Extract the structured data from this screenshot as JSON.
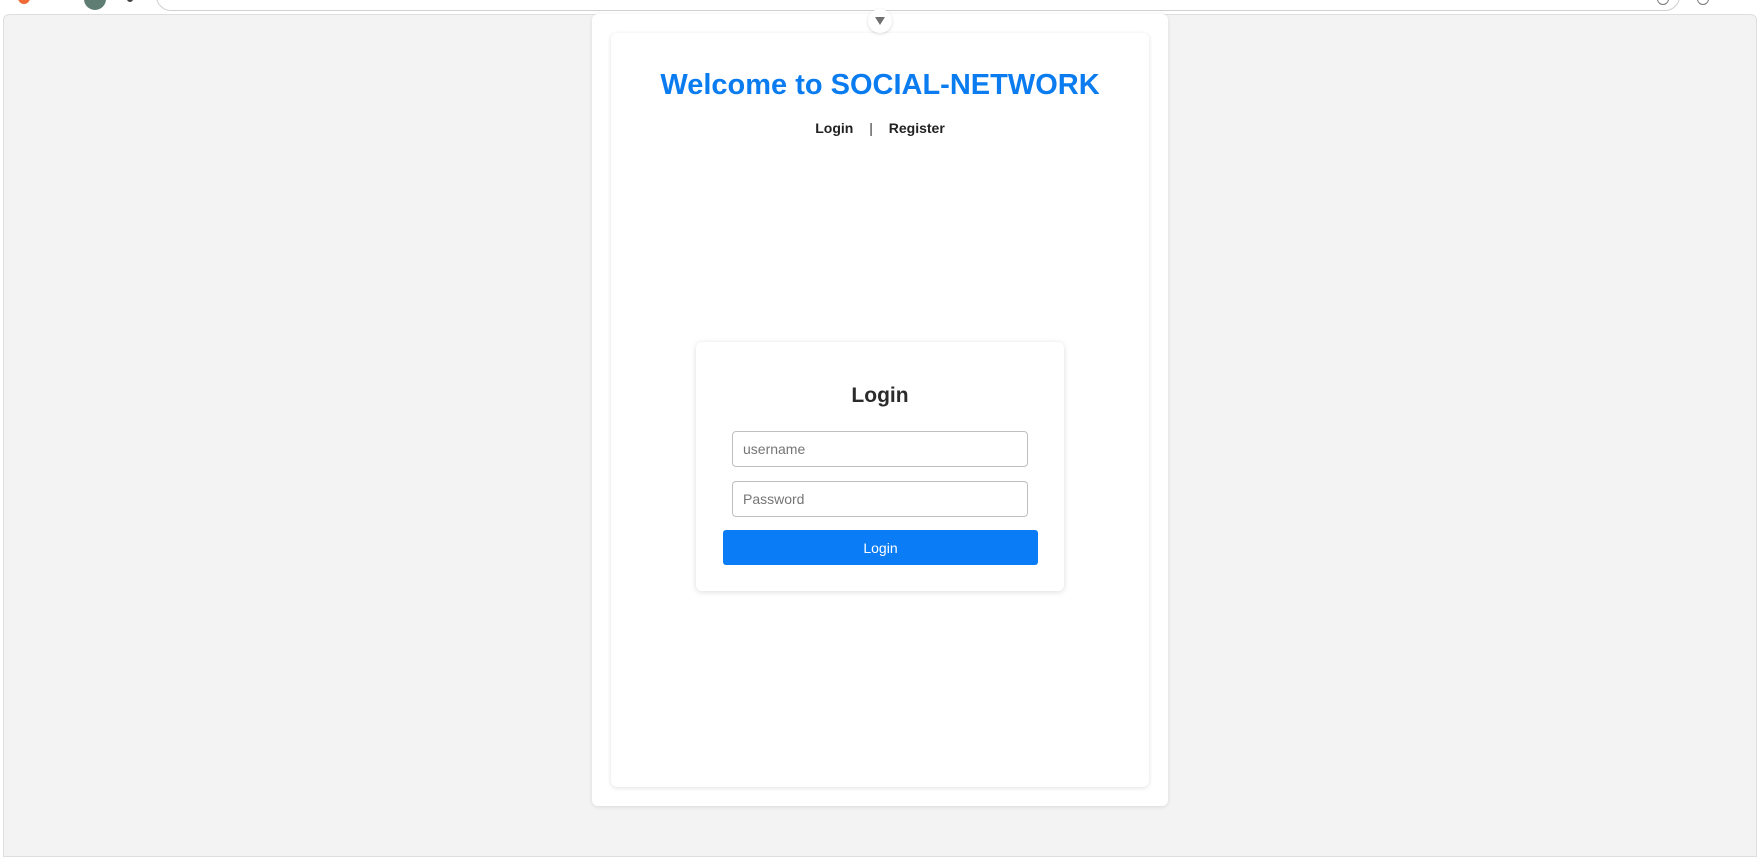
{
  "header": {
    "title": "Welcome to SOCIAL-NETWORK"
  },
  "nav": {
    "login_label": "Login",
    "separator": "|",
    "register_label": "Register"
  },
  "login_form": {
    "heading": "Login",
    "username_placeholder": "username",
    "password_placeholder": "Password",
    "submit_label": "Login"
  },
  "colors": {
    "accent": "#0a7cf0",
    "button": "#0a7cf5",
    "page_background": "#f3f3f3"
  },
  "icons": {
    "collapse": "chevron-down-icon"
  }
}
